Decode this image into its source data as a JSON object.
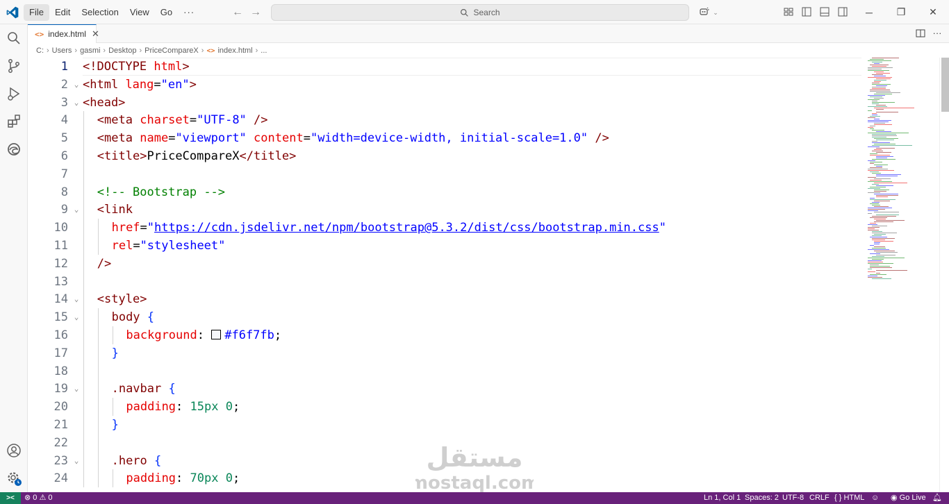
{
  "menu": {
    "items": [
      "File",
      "Edit",
      "Selection",
      "View",
      "Go"
    ],
    "more": "···"
  },
  "search": {
    "placeholder": "Search"
  },
  "tab": {
    "filename": "index.html",
    "icon": "<>",
    "close": "✕"
  },
  "breadcrumb": [
    "C:",
    "Users",
    "gasmi",
    "Desktop",
    "PriceCompareX",
    "index.html",
    "..."
  ],
  "breadcrumb_file_icon": "<>",
  "editor": {
    "current_line": 1,
    "lines": [
      {
        "n": "1",
        "fold": "",
        "indent": 0,
        "html": "<span class='t-tag'>&lt;!DOCTYPE</span> <span class='t-attr'>html</span><span class='t-tag'>&gt;</span>"
      },
      {
        "n": "2",
        "fold": "v",
        "indent": 0,
        "html": "<span class='t-tag'>&lt;html</span> <span class='t-attr'>lang</span><span class='t-txt'>=</span><span class='t-str'>\"en\"</span><span class='t-tag'>&gt;</span>"
      },
      {
        "n": "3",
        "fold": "v",
        "indent": 0,
        "html": "<span class='t-tag'>&lt;head&gt;</span>"
      },
      {
        "n": "4",
        "fold": "",
        "indent": 1,
        "html": "<span class='t-tag'>&lt;meta</span> <span class='t-attr'>charset</span><span class='t-txt'>=</span><span class='t-str'>\"UTF-8\"</span> <span class='t-tag'>/&gt;</span>"
      },
      {
        "n": "5",
        "fold": "",
        "indent": 1,
        "html": "<span class='t-tag'>&lt;meta</span> <span class='t-attr'>name</span><span class='t-txt'>=</span><span class='t-str'>\"viewport\"</span> <span class='t-attr'>content</span><span class='t-txt'>=</span><span class='t-str'>\"width=device-width, initial-scale=1.0\"</span> <span class='t-tag'>/&gt;</span>"
      },
      {
        "n": "6",
        "fold": "",
        "indent": 1,
        "html": "<span class='t-tag'>&lt;title&gt;</span><span class='t-txt'>PriceCompareX</span><span class='t-tag'>&lt;/title&gt;</span>"
      },
      {
        "n": "7",
        "fold": "",
        "indent": 1,
        "html": ""
      },
      {
        "n": "8",
        "fold": "",
        "indent": 1,
        "html": "<span class='t-cm'>&lt;!-- Bootstrap --&gt;</span>"
      },
      {
        "n": "9",
        "fold": "v",
        "indent": 1,
        "html": "<span class='t-tag'>&lt;link</span>"
      },
      {
        "n": "10",
        "fold": "",
        "indent": 2,
        "html": "<span class='t-attr'>href</span><span class='t-txt'>=</span><span class='t-str'>\"<span class='link-u'>https://cdn.jsdelivr.net/npm/bootstrap@5.3.2/dist/css/bootstrap.min.css</span>\"</span>"
      },
      {
        "n": "11",
        "fold": "",
        "indent": 2,
        "html": "<span class='t-attr'>rel</span><span class='t-txt'>=</span><span class='t-str'>\"stylesheet\"</span>"
      },
      {
        "n": "12",
        "fold": "",
        "indent": 1,
        "html": "<span class='t-tag'>/&gt;</span>"
      },
      {
        "n": "13",
        "fold": "",
        "indent": 1,
        "html": ""
      },
      {
        "n": "14",
        "fold": "v",
        "indent": 1,
        "html": "<span class='t-tag'>&lt;style&gt;</span>"
      },
      {
        "n": "15",
        "fold": "v",
        "indent": 2,
        "html": "<span class='t-sel'>body</span> <span class='t-brace'>{</span>"
      },
      {
        "n": "16",
        "fold": "",
        "indent": 3,
        "html": "<span class='t-prop'>background</span><span class='t-txt'>: </span><span class='swatch' style='background:#f6f7fb'></span><span class='t-str'>#f6f7fb</span><span class='t-txt'>;</span>"
      },
      {
        "n": "17",
        "fold": "",
        "indent": 2,
        "html": "<span class='t-brace'>}</span>"
      },
      {
        "n": "18",
        "fold": "",
        "indent": 2,
        "html": ""
      },
      {
        "n": "19",
        "fold": "v",
        "indent": 2,
        "html": "<span class='t-sel'>.navbar</span> <span class='t-brace'>{</span>"
      },
      {
        "n": "20",
        "fold": "",
        "indent": 3,
        "html": "<span class='t-prop'>padding</span><span class='t-txt'>: </span><span class='t-num'>15px</span> <span class='t-num'>0</span><span class='t-txt'>;</span>"
      },
      {
        "n": "21",
        "fold": "",
        "indent": 2,
        "html": "<span class='t-brace'>}</span>"
      },
      {
        "n": "22",
        "fold": "",
        "indent": 2,
        "html": ""
      },
      {
        "n": "23",
        "fold": "v",
        "indent": 2,
        "html": "<span class='t-sel'>.hero</span> <span class='t-brace'>{</span>"
      },
      {
        "n": "24",
        "fold": "",
        "indent": 3,
        "html": "<span class='t-prop'>padding</span><span class='t-txt'>: </span><span class='t-num'>70px</span> <span class='t-num'>0</span><span class='t-txt'>;</span>"
      }
    ]
  },
  "statusbar": {
    "remote_icon": "><",
    "errors": "0",
    "warnings": "0",
    "position": "Ln 1, Col 1",
    "spaces": "Spaces: 2",
    "encoding": "UTF-8",
    "eol": "CRLF",
    "language": "HTML",
    "golive": "Go Live"
  },
  "watermark": {
    "arabic": "مستقل",
    "latin": "mostaql.com"
  }
}
